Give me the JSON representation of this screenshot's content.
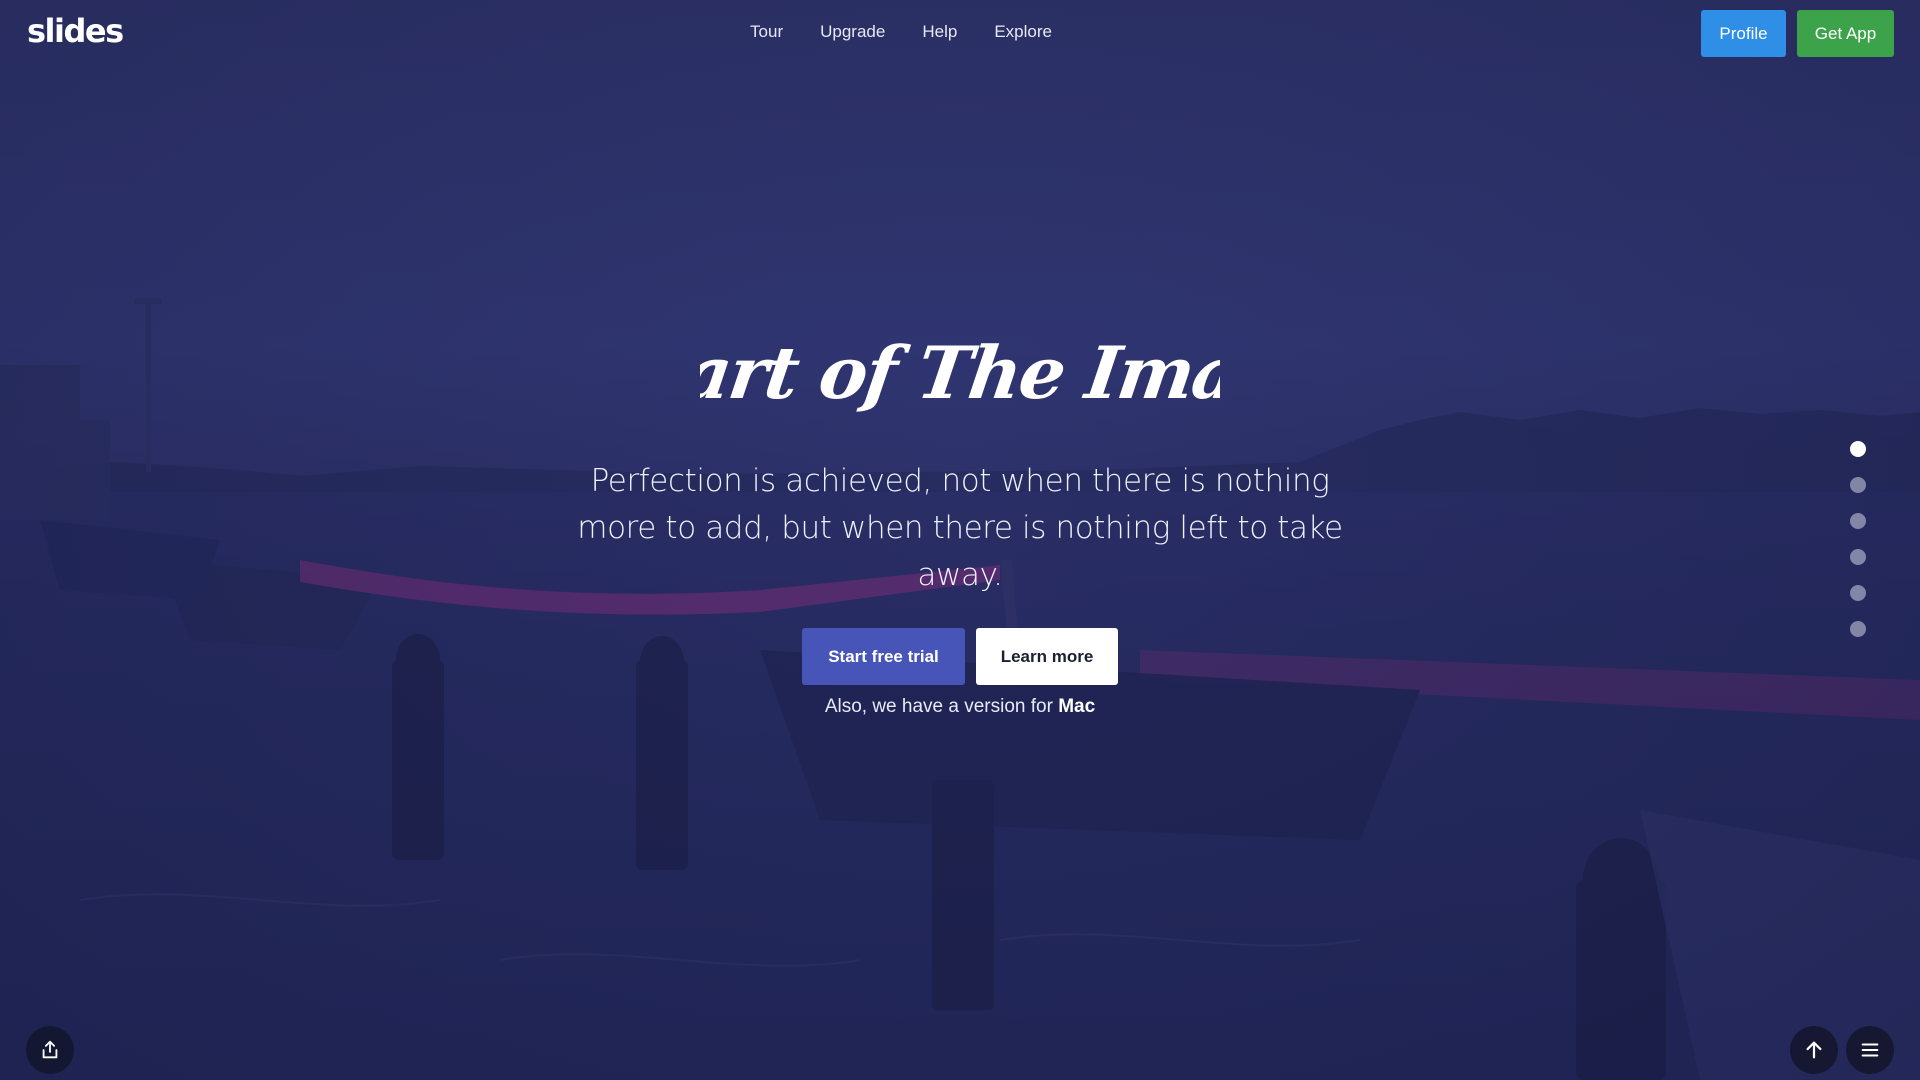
{
  "brand": {
    "logo": "slides"
  },
  "nav": {
    "items": [
      "Tour",
      "Upgrade",
      "Help",
      "Explore"
    ]
  },
  "header_buttons": {
    "profile": "Profile",
    "get_app": "Get App"
  },
  "hero": {
    "title": "Heart of The Image",
    "quote": "Perfection is achieved, not when there is nothing more to add, but when there is nothing left to take away.",
    "primary_cta": "Start free trial",
    "secondary_cta": "Learn more",
    "alt_prefix": "Also, we have a version for",
    "alt_platform": "Mac"
  },
  "slide_dots": {
    "count": 6,
    "active_index": 0
  },
  "icons": {
    "share": "share-icon",
    "scroll_up": "arrow-up-icon",
    "menu": "hamburger-menu-icon"
  },
  "colors": {
    "profile_button": "#2f8ee6",
    "get_app_button": "#3da34a",
    "primary_cta": "#4655b7",
    "overlay": "#2d3268"
  }
}
